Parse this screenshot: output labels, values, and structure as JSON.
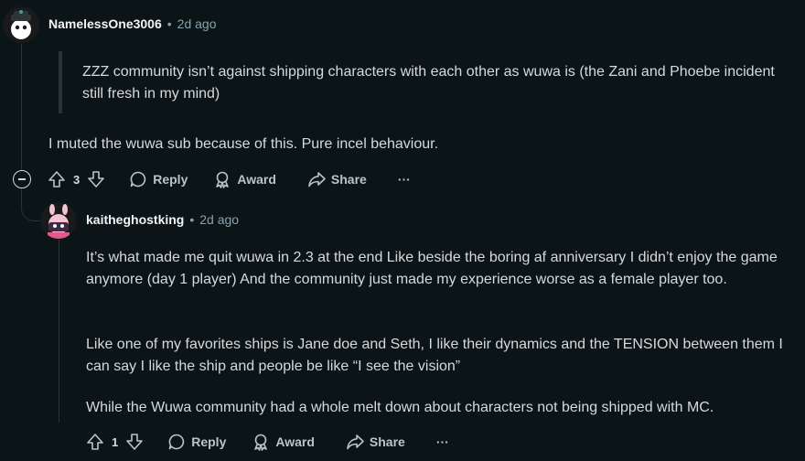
{
  "comments": [
    {
      "username": "NamelessOne3006",
      "age": "2d ago",
      "quote": "ZZZ community isn’t against shipping characters with each other as wuwa is (the Zani and Phoebe incident still fresh in my mind)",
      "body": [
        "I muted the wuwa sub because of this. Pure incel behaviour."
      ],
      "votes": "3",
      "actions": {
        "reply": "Reply",
        "award": "Award",
        "share": "Share",
        "more": "···"
      }
    },
    {
      "username": "kaitheghostking",
      "age": "2d ago",
      "body": [
        "It’s what made me quit wuwa in 2.3 at the end Like beside the boring af anniversary I didn’t enjoy the game anymore (day 1 player) And the community just made my experience worse as a female player too.",
        "Like one of my favorites ships is Jane doe and Seth, I like their dynamics and the TENSION between them I can say I like the ship and people be like “I see the vision”",
        "While the Wuwa community had a whole melt down about characters not being shipped with MC."
      ],
      "votes": "1",
      "actions": {
        "reply": "Reply",
        "award": "Award",
        "share": "Share",
        "more": "···"
      }
    }
  ],
  "separator": "•",
  "colors": {
    "background": "#0b1416",
    "text": "#d7dadc",
    "meta": "#8ba2ad",
    "thread_line": "#2a3236"
  }
}
